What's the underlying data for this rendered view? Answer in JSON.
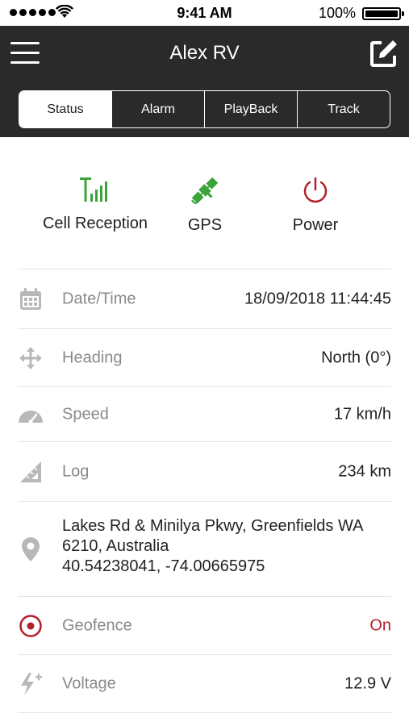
{
  "status_bar": {
    "time": "9:41 AM",
    "battery_percent": "100%",
    "battery_level": 1.0
  },
  "header": {
    "title": "Alex RV",
    "menu_icon": "hamburger-menu-icon",
    "edit_icon": "edit-icon"
  },
  "tabs": [
    {
      "label": "Status",
      "active": true
    },
    {
      "label": "Alarm",
      "active": false
    },
    {
      "label": "PlayBack",
      "active": false
    },
    {
      "label": "Track",
      "active": false
    }
  ],
  "status_icons": [
    {
      "label": "Cell Reception",
      "icon": "cell-signal-icon",
      "color": "#3aa33a"
    },
    {
      "label": "GPS",
      "icon": "satellite-icon",
      "color": "#3aa33a"
    },
    {
      "label": "Power",
      "icon": "power-icon",
      "color": "#b3202a"
    }
  ],
  "details": {
    "datetime": {
      "label": "Date/Time",
      "value": "18/09/2018 11:44:45",
      "icon": "calendar-icon"
    },
    "heading": {
      "label": "Heading",
      "value": "North (0°)",
      "icon": "move-arrows-icon"
    },
    "speed": {
      "label": "Speed",
      "value": "17 km/h",
      "icon": "speedometer-icon"
    },
    "log": {
      "label": "Log",
      "value": "234 km",
      "icon": "ruler-triangle-icon"
    },
    "location": {
      "icon": "location-pin-icon",
      "address_line1": "Lakes Rd & Minilya Pkwy, Greenfields WA",
      "address_line2": "6210, Australia",
      "coordinates": "40.54238041, -74.00665975"
    },
    "geofence": {
      "label": "Geofence",
      "value": "On",
      "icon": "geofence-target-icon"
    },
    "voltage": {
      "label": "Voltage",
      "value": "12.9 V",
      "icon": "voltage-bolt-icon"
    }
  },
  "colors": {
    "header_bg": "#2a2a2a",
    "status_ok": "#3aa33a",
    "alert_red": "#b3202a",
    "muted_text": "#8a8a8a"
  }
}
